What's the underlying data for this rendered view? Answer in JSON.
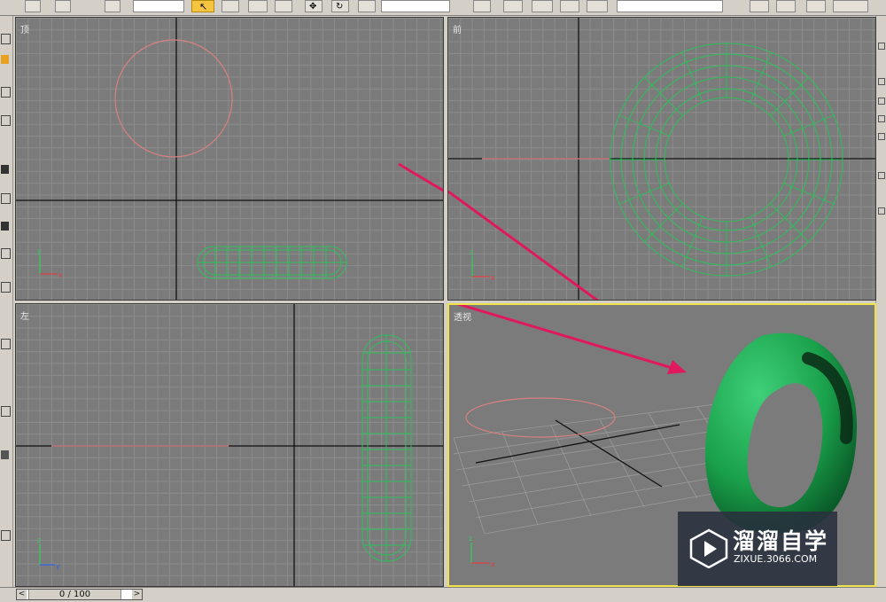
{
  "viewports": {
    "top": {
      "label": "顶"
    },
    "front": {
      "label": "前"
    },
    "left": {
      "label": "左"
    },
    "perspective": {
      "label": "透视"
    }
  },
  "axis_labels": {
    "x": "x",
    "y": "y",
    "z": "z"
  },
  "time_slider": {
    "prev": "<",
    "next": ">",
    "frame_text": "0 / 100"
  },
  "watermark": {
    "brand": "溜溜自学",
    "url": "ZIXUE.3066.COM"
  },
  "colors": {
    "viewport_bg": "#7b7b7b",
    "grid": "#8c8c8c",
    "active_viewport_border": "#f1e24a",
    "torus": "#1aa04a",
    "circle_spline": "#d98080",
    "annotation_arrow": "#e0185e"
  },
  "icons": {
    "select": "cursor-arrow-icon",
    "move": "move-icon",
    "rotate": "rotate-icon"
  }
}
